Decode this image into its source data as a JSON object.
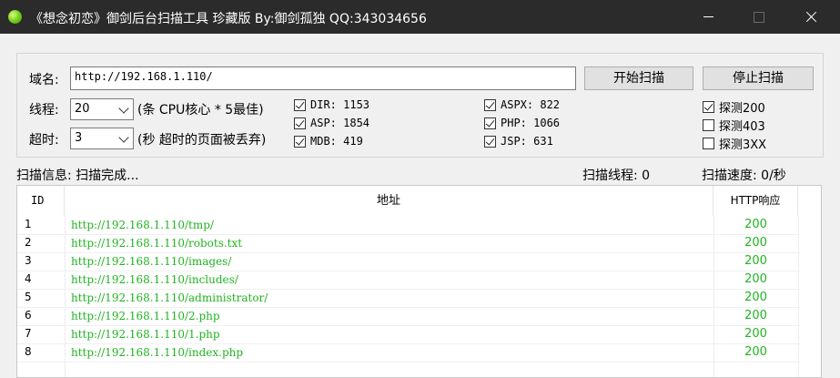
{
  "window": {
    "title": "《想念初恋》御剑后台扫描工具 珍藏版 By:御剑孤独 QQ:343034656",
    "icon": "green-orb-icon",
    "controls": {
      "minimize": "minimize-icon",
      "maximize": "maximize-icon",
      "close": "close-icon"
    }
  },
  "form": {
    "domain_label": "域名:",
    "domain_value": "http://192.168.1.110/",
    "start_button": "开始扫描",
    "stop_button": "停止扫描",
    "threads_label": "线程:",
    "threads_value": "20",
    "threads_hint": "(条 CPU核心 * 5最佳)",
    "timeout_label": "超时:",
    "timeout_value": "3",
    "timeout_hint": "(秒 超时的页面被丢弃)"
  },
  "dictionaries": [
    {
      "label": "DIR: 1153",
      "checked": true
    },
    {
      "label": "ASP: 1854",
      "checked": true
    },
    {
      "label": "MDB: 419",
      "checked": true
    },
    {
      "label": "ASPX: 822",
      "checked": true
    },
    {
      "label": "PHP: 1066",
      "checked": true
    },
    {
      "label": "JSP: 631",
      "checked": true
    }
  ],
  "detect": [
    {
      "label": "探测200",
      "checked": true
    },
    {
      "label": "探测403",
      "checked": false
    },
    {
      "label": "探测3XX",
      "checked": false
    }
  ],
  "status": {
    "info": "扫描信息: 扫描完成...",
    "threads": "扫描线程: 0",
    "speed": "扫描速度: 0/秒"
  },
  "results": {
    "headers": {
      "id": "ID",
      "url": "地址",
      "code": "HTTP响应"
    },
    "rows": [
      {
        "id": "1",
        "url": "http://192.168.1.110/tmp/",
        "code": "200"
      },
      {
        "id": "2",
        "url": "http://192.168.1.110/robots.txt",
        "code": "200"
      },
      {
        "id": "3",
        "url": "http://192.168.1.110/images/",
        "code": "200"
      },
      {
        "id": "4",
        "url": "http://192.168.1.110/includes/",
        "code": "200"
      },
      {
        "id": "5",
        "url": "http://192.168.1.110/administrator/",
        "code": "200"
      },
      {
        "id": "6",
        "url": "http://192.168.1.110/2.php",
        "code": "200"
      },
      {
        "id": "7",
        "url": "http://192.168.1.110/1.php",
        "code": "200"
      },
      {
        "id": "8",
        "url": "http://192.168.1.110/index.php",
        "code": "200"
      }
    ]
  },
  "colors": {
    "titlebar": "#2b2b2b",
    "result_green": "#22b322"
  }
}
